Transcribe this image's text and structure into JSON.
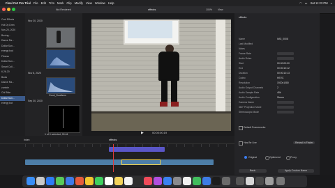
{
  "menubar": {
    "app": "Final Cut Pro Trial",
    "items": [
      "File",
      "Edit",
      "Trim",
      "Mark",
      "Clip",
      "Modify",
      "View",
      "Window",
      "Help"
    ],
    "clock": "Sat 11:23 PM"
  },
  "toolbar": {
    "library_label": "Not Rendered",
    "viewer_title": "effects",
    "zoom": "100%",
    "view_label": "View"
  },
  "libraries": {
    "items": [
      {
        "label": "Cool Effects"
      },
      {
        "label": "Hot Dy Dren"
      },
      {
        "label": "Nov 20, 2020"
      },
      {
        "label": "Boxing..."
      },
      {
        "label": "Dance Ra..."
      },
      {
        "label": "Dollar Sun..."
      },
      {
        "label": "energy bod"
      },
      {
        "label": "Fitness"
      },
      {
        "label": "Dollar Sun..."
      },
      {
        "label": "Smart Coll..."
      },
      {
        "label": "6-26-20"
      },
      {
        "label": "Boda"
      },
      {
        "label": "Dance Ra..."
      },
      {
        "label": "zombie"
      },
      {
        "label": "Chi Ride"
      },
      {
        "label": "Dollar Sun..."
      },
      {
        "label": "energy bot"
      }
    ]
  },
  "browser": {
    "date1": "Nov 20, 2020",
    "date2": "Nov 8, 2020",
    "date3": "Sep 30, 2020",
    "clip_label": "Good_Dualisms",
    "footer": "1 of 9 selected, 00:44"
  },
  "viewer": {
    "timecode": "00:00:00:19"
  },
  "inspector": {
    "title": "effects",
    "rows": [
      {
        "k": "Name",
        "v": "IMG_0008"
      },
      {
        "k": "Last Modified",
        "v": ""
      },
      {
        "k": "Notes",
        "v": ""
      },
      {
        "k": "Frame Rate",
        "v": ""
      },
      {
        "k": "Audio Roles",
        "v": ""
      },
      {
        "k": "Start",
        "v": "00:00:00:00"
      },
      {
        "k": "End",
        "v": "00:00:10:12"
      },
      {
        "k": "Duration",
        "v": "00:00:10:13"
      },
      {
        "k": "Codec",
        "v": "HEVC"
      },
      {
        "k": "Resolution",
        "v": "1920x1080"
      },
      {
        "k": "Audio Output Channels",
        "v": "2"
      },
      {
        "k": "Audio Sample Rate",
        "v": "48k"
      },
      {
        "k": "Audio Configuration",
        "v": "Stereo"
      },
      {
        "k": "Camera Name",
        "v": ""
      },
      {
        "k": "360° Projection Mode",
        "v": ""
      },
      {
        "k": "Stereoscopic Mode",
        "v": ""
      }
    ],
    "checkbox1": "Default Frameworks",
    "checkbox2": "Has Be Live",
    "option1": "Original",
    "option2": "Optimized",
    "option3": "Proxy",
    "basic_label": "Basic",
    "apply_label": "Apply Custom Name",
    "reveal_label": "Reveal in Finder"
  },
  "timeline": {
    "project_label": "effects",
    "index_label": "Index"
  }
}
